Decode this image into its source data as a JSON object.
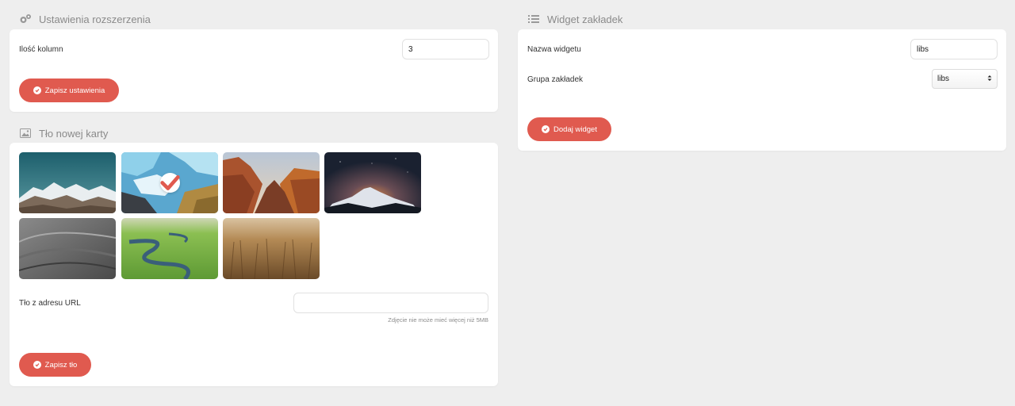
{
  "settings": {
    "title": "Ustawienia rozszerzenia",
    "columns_label": "Ilość kolumn",
    "columns_value": "3",
    "save_label": "Zapisz ustawienia"
  },
  "background": {
    "title": "Tło nowej karty",
    "thumbnails": [
      {
        "name": "glacier-mountains",
        "selected": false
      },
      {
        "name": "ice-river",
        "selected": true
      },
      {
        "name": "canyon-sunset",
        "selected": false
      },
      {
        "name": "night-mountain",
        "selected": false
      },
      {
        "name": "grey-sand",
        "selected": false
      },
      {
        "name": "green-river",
        "selected": false
      },
      {
        "name": "wheat-field",
        "selected": false
      }
    ],
    "url_label": "Tło z adresu URL",
    "url_value": "",
    "url_hint": "Zdjęcie nie może mieć więcej niż 5MB",
    "save_label": "Zapisz tło"
  },
  "widget": {
    "title": "Widget zakładek",
    "name_label": "Nazwa widgetu",
    "name_value": "libs",
    "group_label": "Grupa zakładek",
    "group_value": "libs",
    "add_label": "Dodaj widget"
  },
  "colors": {
    "accent": "#e05a4f",
    "background": "#eeeeee",
    "card": "#ffffff"
  }
}
